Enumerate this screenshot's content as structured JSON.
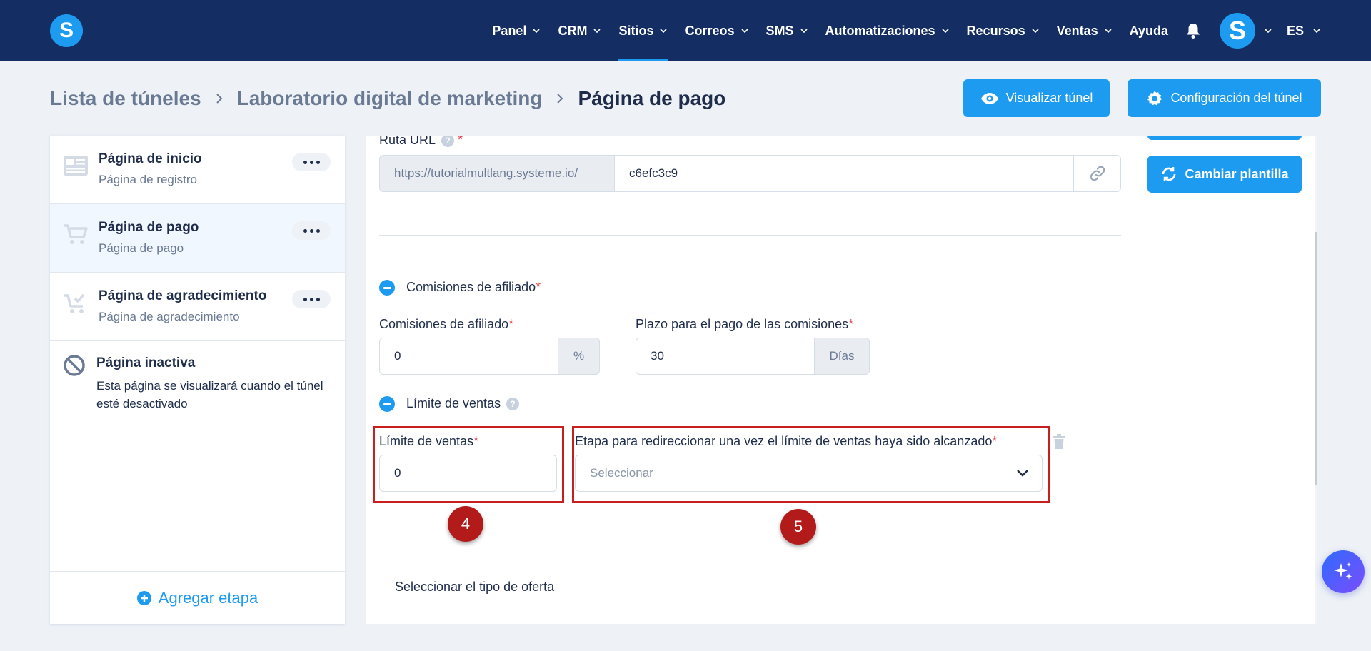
{
  "nav": {
    "logo_letter": "S",
    "items": [
      {
        "label": "Panel",
        "has_menu": true
      },
      {
        "label": "CRM",
        "has_menu": true
      },
      {
        "label": "Sitios",
        "has_menu": true,
        "active": true
      },
      {
        "label": "Correos",
        "has_menu": true
      },
      {
        "label": "SMS",
        "has_menu": true
      },
      {
        "label": "Automatizaciones",
        "has_menu": true
      },
      {
        "label": "Recursos",
        "has_menu": true
      },
      {
        "label": "Ventas",
        "has_menu": true
      },
      {
        "label": "Ayuda",
        "has_menu": false
      }
    ],
    "avatar_letter": "S",
    "language": "ES"
  },
  "header": {
    "crumbs": [
      "Lista de túneles",
      "Laboratorio digital de marketing"
    ],
    "current": "Página de pago",
    "preview_button": "Visualizar túnel",
    "settings_button": "Configuración del túnel"
  },
  "sidebar": {
    "steps": [
      {
        "title": "Página de inicio",
        "subtitle": "Página de registro",
        "icon": "landing-page-icon"
      },
      {
        "title": "Página de pago",
        "subtitle": "Página de pago",
        "icon": "cart-icon",
        "selected": true
      },
      {
        "title": "Página de agradecimiento",
        "subtitle": "Página de agradecimiento",
        "icon": "cart-check-icon"
      }
    ],
    "inactive": {
      "title": "Página inactiva",
      "description": "Esta página se visualizará cuando el túnel esté desactivado"
    },
    "add_step": "Agregar etapa"
  },
  "main": {
    "url": {
      "label": "Ruta URL",
      "prefix": "https://tutorialmultlang.systeme.io/",
      "value": "c6efc3c9"
    },
    "change_template_button": "Cambiar plantilla",
    "affiliate": {
      "section_title": "Comisiones de afiliado",
      "commission_label": "Comisiones de afiliado",
      "commission_value": "0",
      "commission_unit": "%",
      "term_label": "Plazo para el pago de las comisiones",
      "term_value": "30",
      "term_unit": "Días"
    },
    "sales_limit": {
      "section_title": "Límite de ventas",
      "limit_label": "Límite de ventas",
      "limit_value": "0",
      "redirect_label": "Etapa para redireccionar una vez el límite de ventas haya sido alcanzado",
      "redirect_placeholder": "Seleccionar"
    },
    "offer_type_label": "Seleccionar el tipo de oferta",
    "markers": [
      "4",
      "5"
    ]
  },
  "colors": {
    "navbar": "#142e63",
    "primary": "#1d9bf0",
    "annotation_red": "#c81e1e"
  }
}
